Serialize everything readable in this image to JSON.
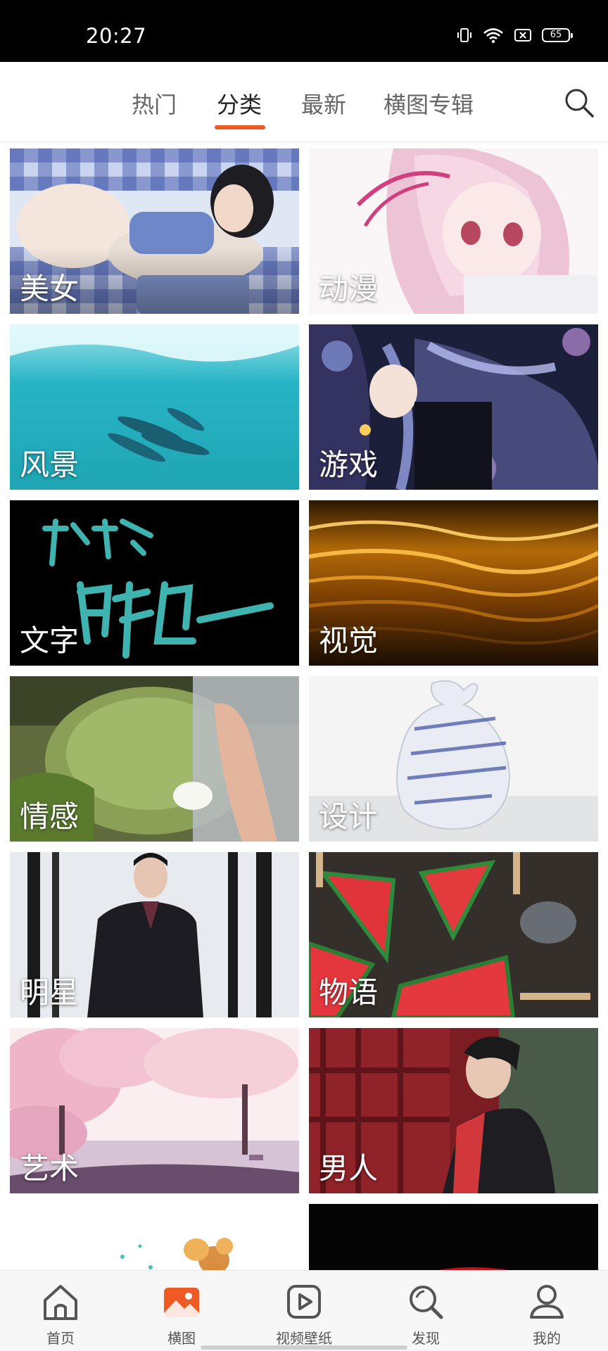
{
  "status_bar": {
    "time": "20:27",
    "battery": "65",
    "icons": [
      "vibrate-icon",
      "wifi-icon",
      "sim-blocked-icon",
      "battery-icon"
    ]
  },
  "top_tabs": [
    {
      "label": "热门",
      "active": false
    },
    {
      "label": "分类",
      "active": true
    },
    {
      "label": "最新",
      "active": false
    },
    {
      "label": "横图专辑",
      "active": false
    }
  ],
  "accent_color": "#ee5a24",
  "categories": [
    {
      "label": "美女"
    },
    {
      "label": "动漫"
    },
    {
      "label": "风景"
    },
    {
      "label": "游戏"
    },
    {
      "label": "文字"
    },
    {
      "label": "视觉"
    },
    {
      "label": "情感"
    },
    {
      "label": "设计"
    },
    {
      "label": "明星"
    },
    {
      "label": "物语"
    },
    {
      "label": "艺术"
    },
    {
      "label": "男人"
    },
    {
      "label": ""
    },
    {
      "label": ""
    }
  ],
  "bottom_nav": [
    {
      "label": "首页",
      "icon": "home-icon",
      "active": false
    },
    {
      "label": "横图",
      "icon": "image-icon",
      "active": true
    },
    {
      "label": "视频壁纸",
      "icon": "video-play-icon",
      "active": false
    },
    {
      "label": "发现",
      "icon": "discover-search-icon",
      "active": false
    },
    {
      "label": "我的",
      "icon": "profile-icon",
      "active": false
    }
  ]
}
